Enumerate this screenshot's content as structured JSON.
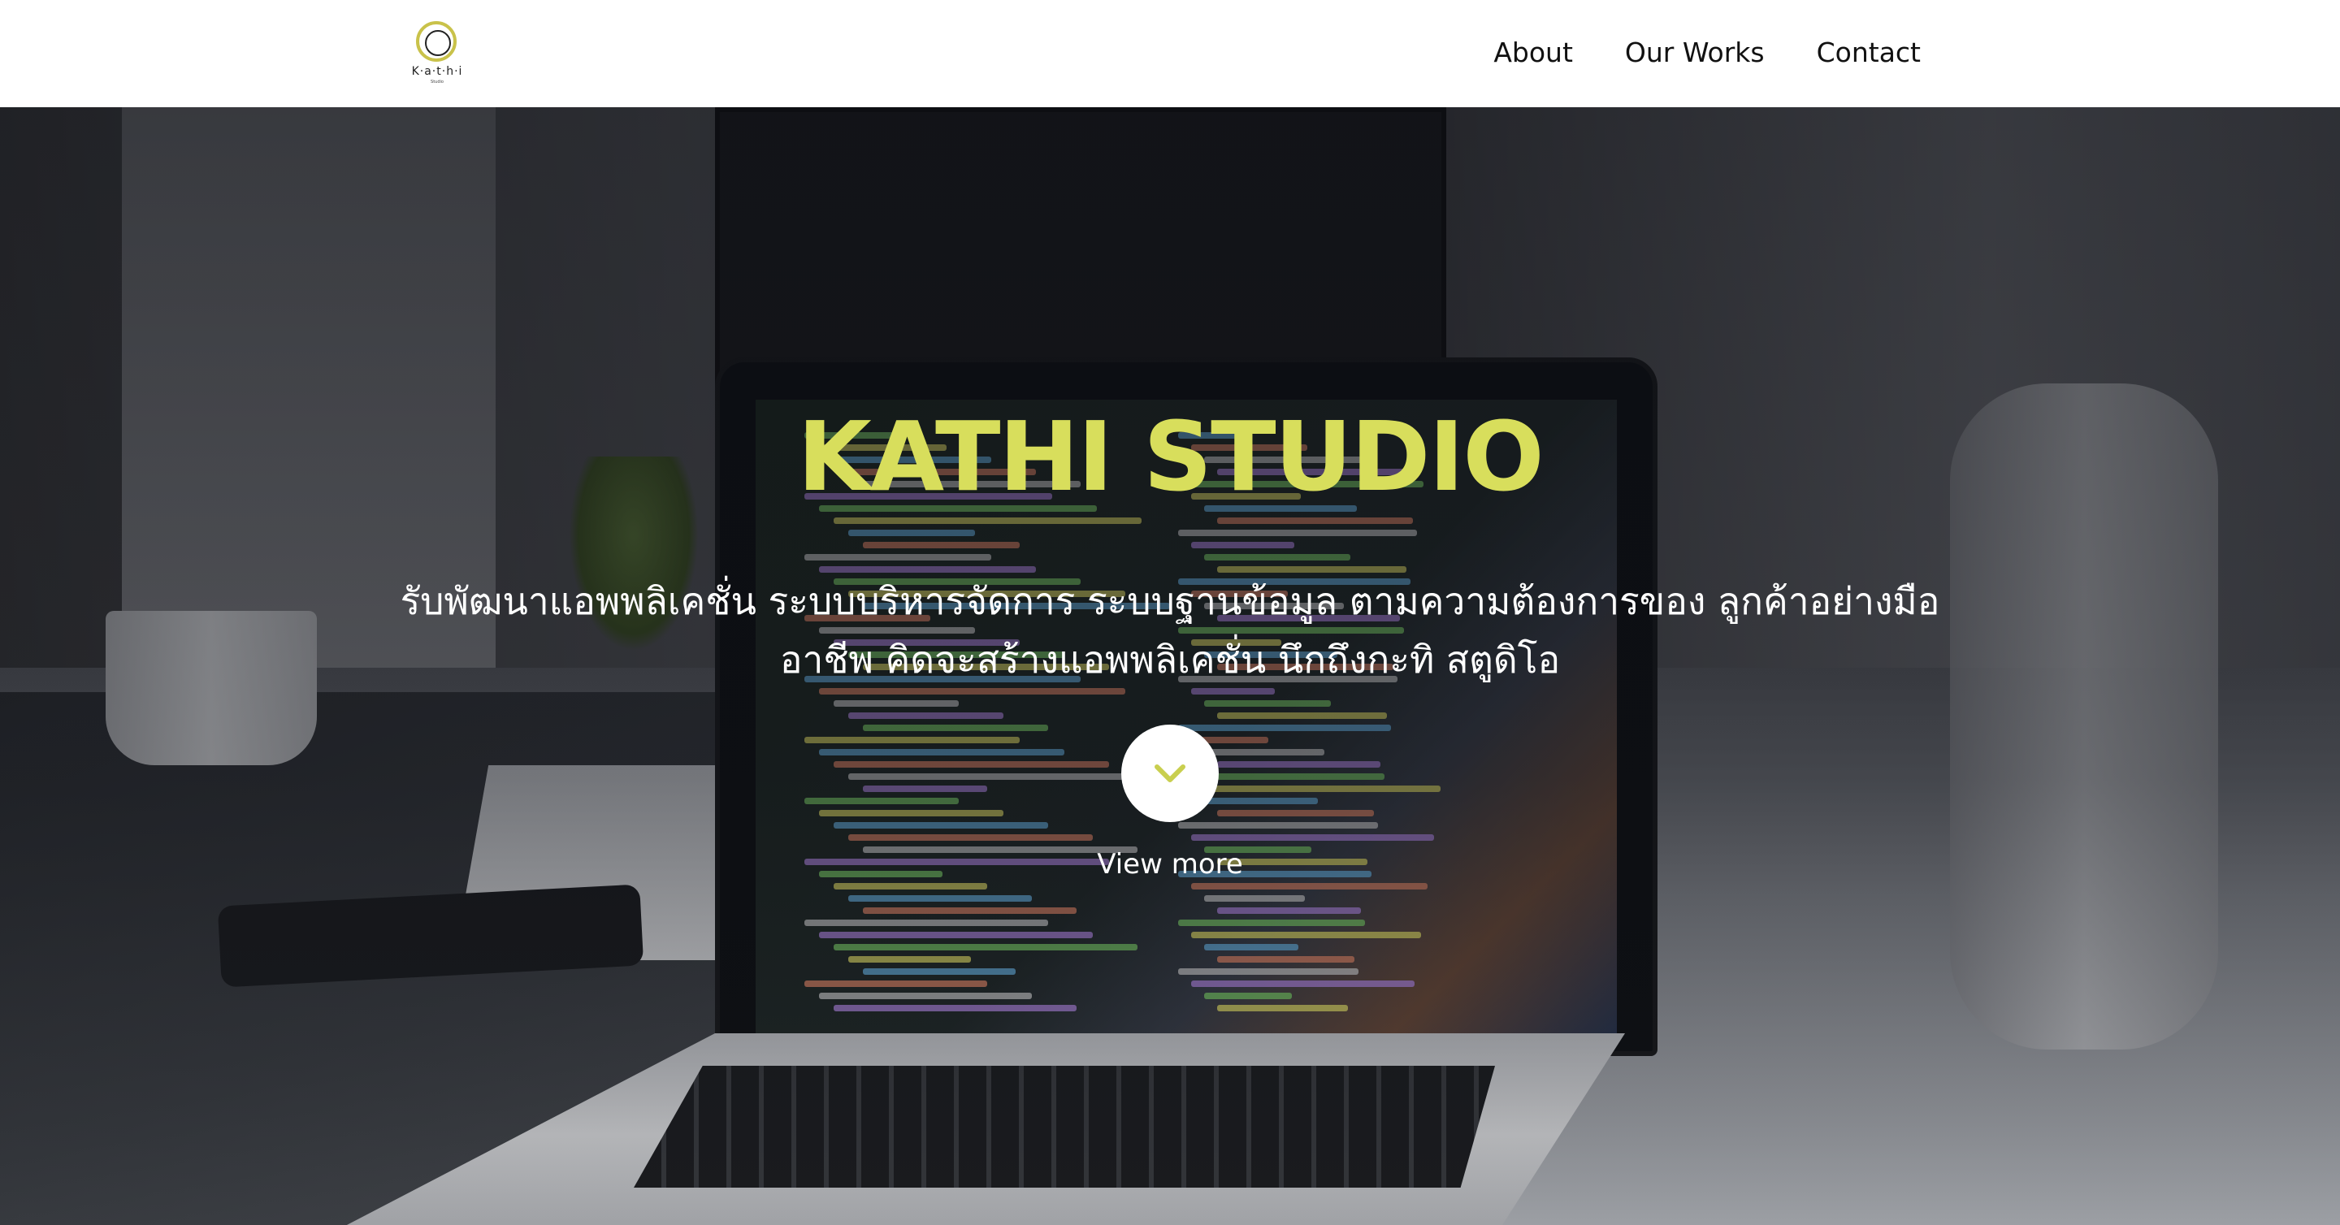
{
  "logo": {
    "text": "K·a·t·h·i",
    "sub": "Studio",
    "accent_color": "#c9c24a"
  },
  "nav": {
    "items": [
      {
        "label": "About"
      },
      {
        "label": "Our Works"
      },
      {
        "label": "Contact"
      }
    ]
  },
  "hero": {
    "title": "KATHI STUDIO",
    "title_color": "#d8de5c",
    "description": "รับพัฒนาแอพพลิเคชั่น ระบบบริหารจัดการ ระบบฐานข้อมูล ตามความต้องการของ ลูกค้าอย่างมืออาชีพ คิดจะสร้างแอพพลิเคชั่น นึกถึงกะทิ สตูดิโอ",
    "more_icon": "chevron-down-icon",
    "more_label": "View more"
  }
}
